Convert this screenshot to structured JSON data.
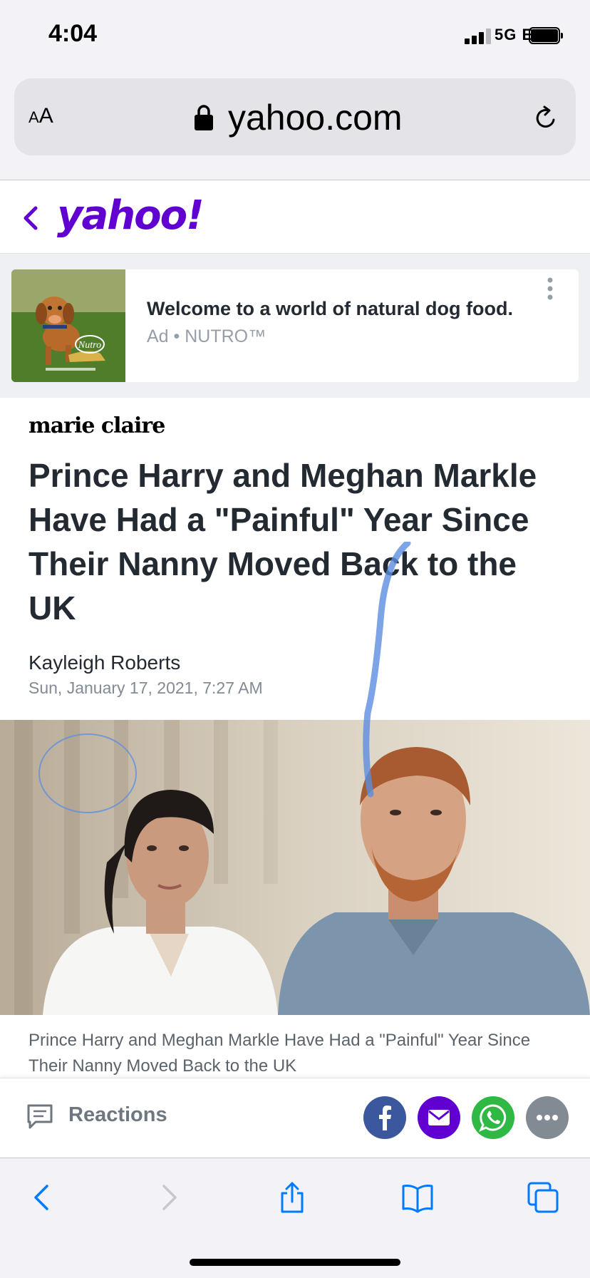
{
  "status_bar": {
    "time": "4:04",
    "network": "5G E"
  },
  "browser": {
    "text_size_label_small": "A",
    "text_size_label_large": "A",
    "url": "yahoo.com"
  },
  "header": {
    "logo": "yahoo!"
  },
  "ad": {
    "title": "Welcome to a world of natural dog food.",
    "meta": "Ad • NUTRO™",
    "brand_in_image": "Nutro"
  },
  "article": {
    "publisher": "marie claire",
    "headline": "Prince Harry and Meghan Markle Have Had a \"Painful\" Year Since Their Nanny Moved Back to the UK",
    "author": "Kayleigh Roberts",
    "date": "Sun, January 17, 2021, 7:27 AM",
    "caption": "Prince Harry and Meghan Markle Have Had a \"Painful\" Year Since Their Nanny Moved Back to the UK"
  },
  "reactions": {
    "label": "Reactions"
  },
  "share_icons": [
    "facebook-icon",
    "mail-icon",
    "whatsapp-icon",
    "more-icon"
  ],
  "toolbar_icons": [
    "back-icon",
    "forward-icon",
    "share-icon",
    "bookmarks-icon",
    "tabs-icon"
  ],
  "colors": {
    "yahoo_purple": "#6001d2",
    "facebook": "#3b579d",
    "whatsapp": "#2fb844",
    "ios_blue": "#007aff",
    "annotation_blue": "#5b8de0"
  }
}
